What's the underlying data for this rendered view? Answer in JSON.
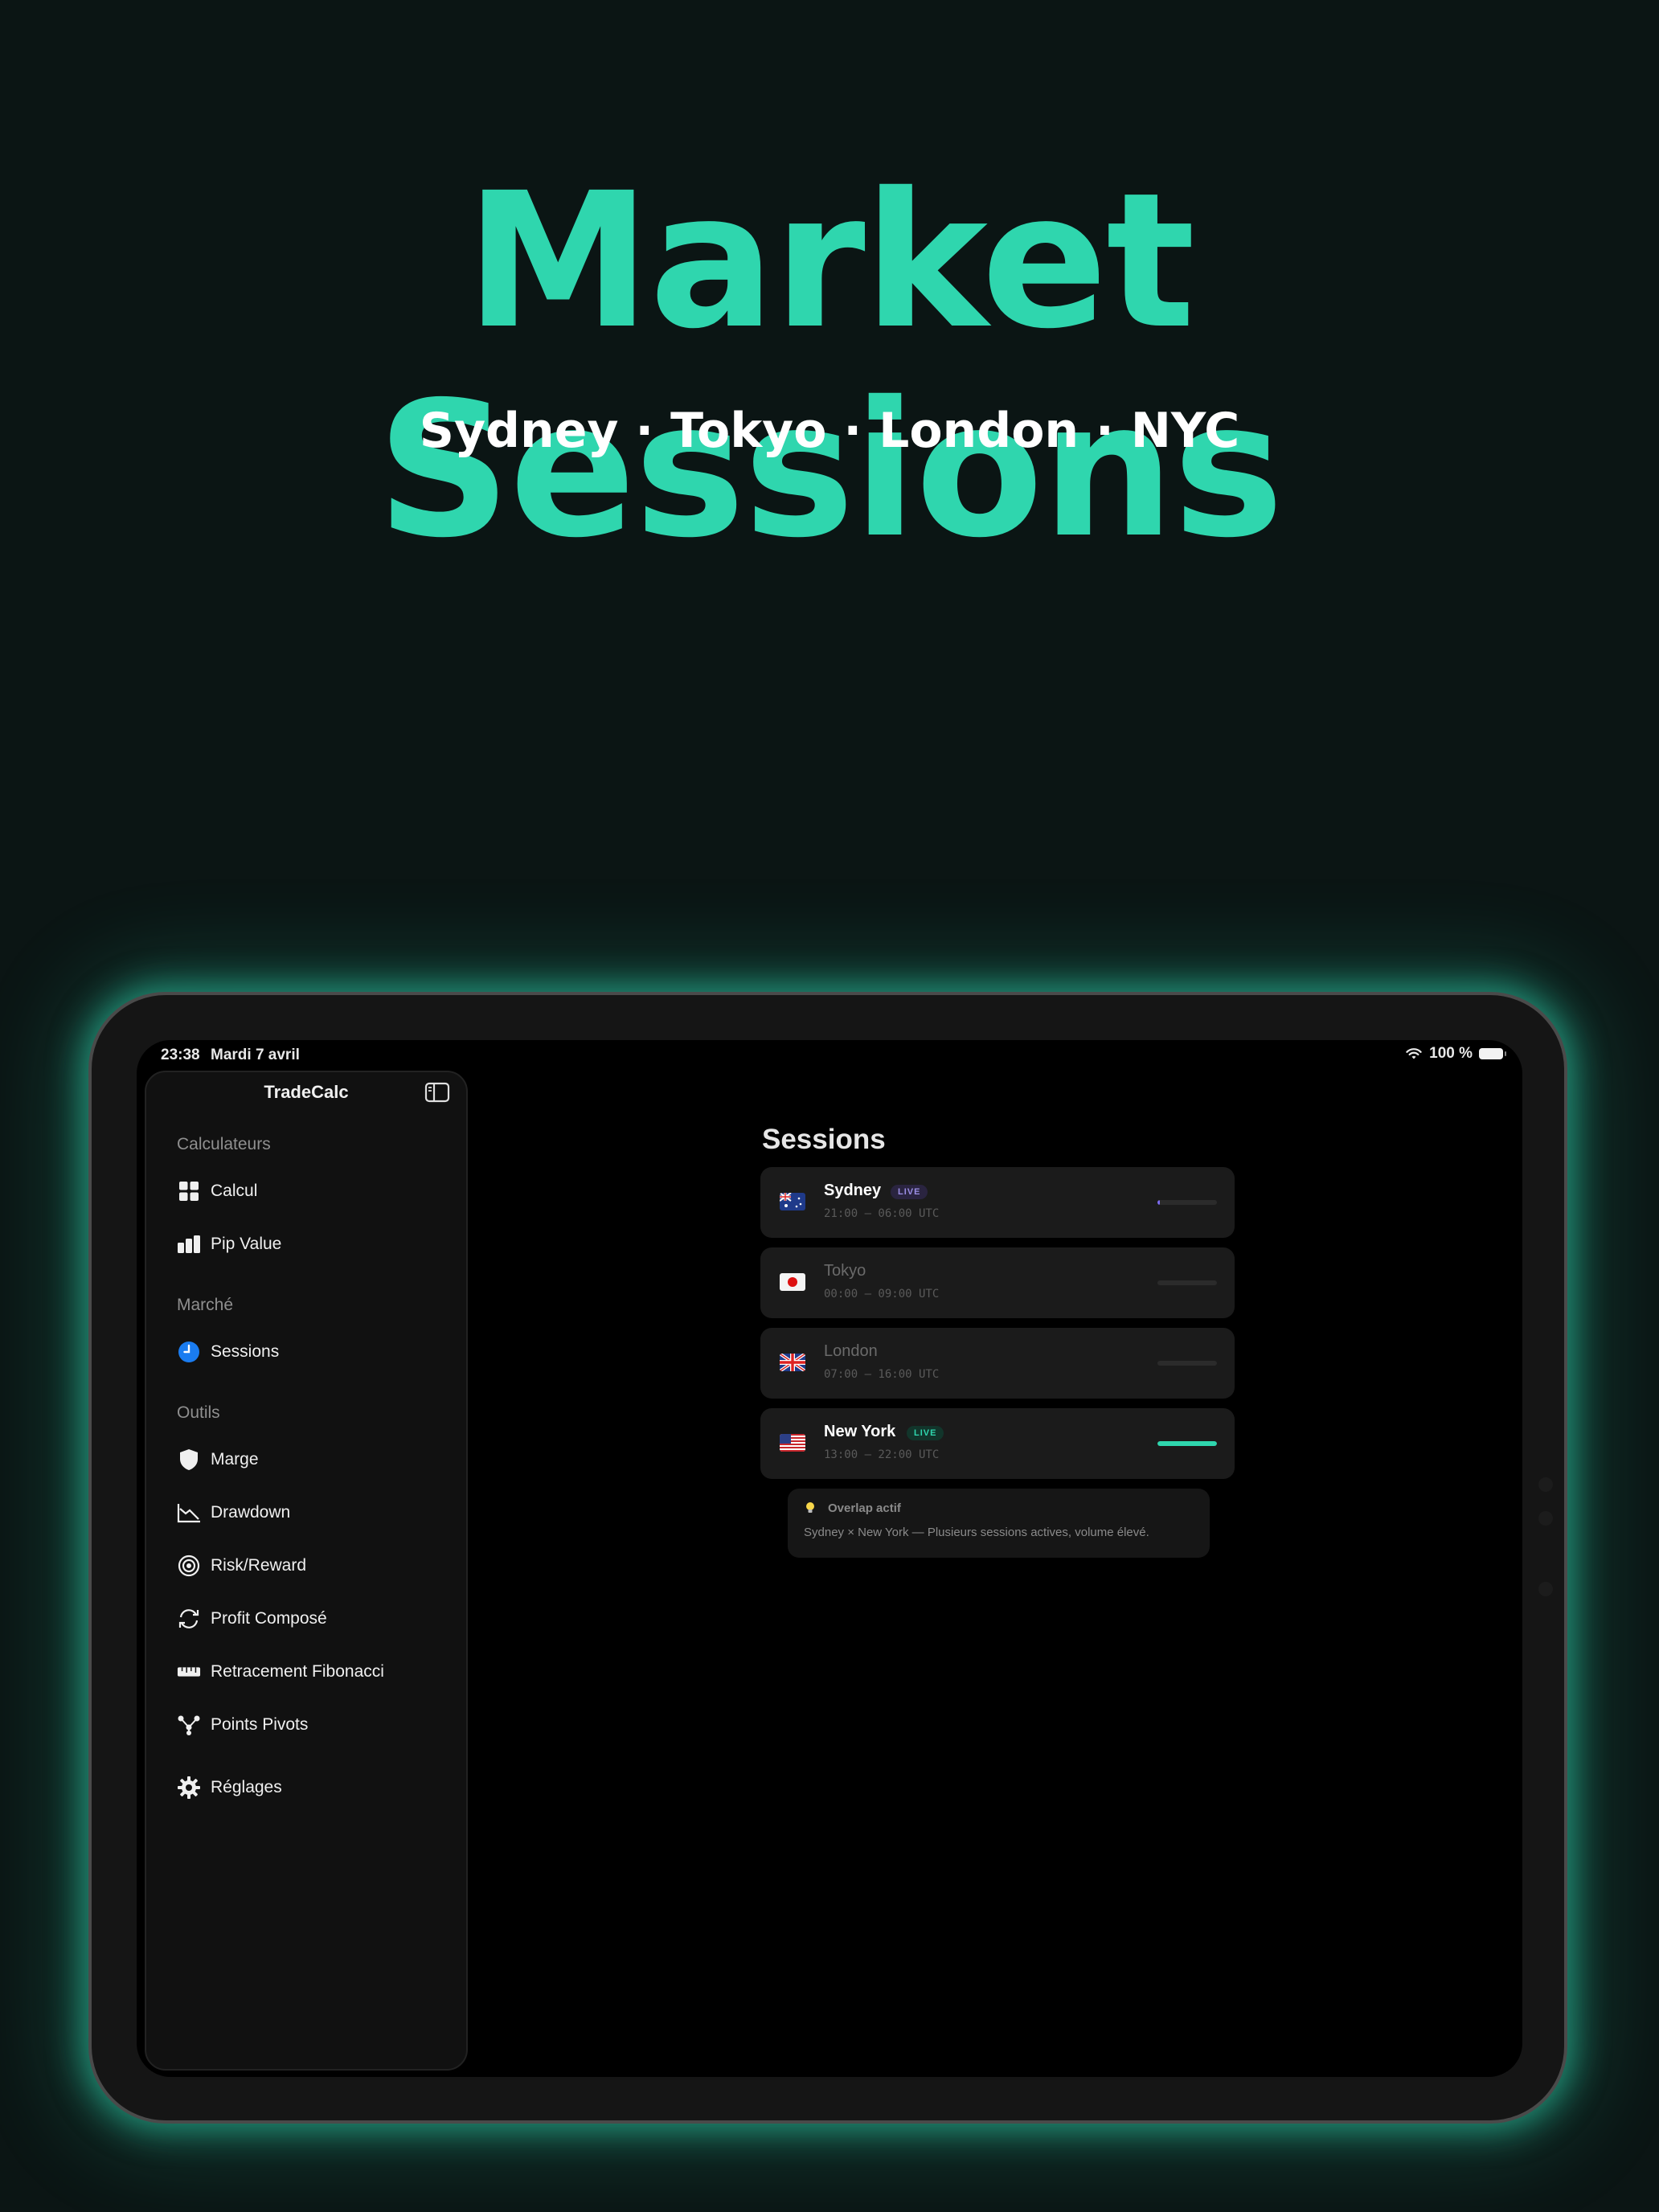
{
  "hero": {
    "title": "Market Sessions",
    "subtitle": "Sydney · Tokyo · London · NYC"
  },
  "status_bar": {
    "time": "23:38",
    "date": "Mardi 7 avril",
    "battery": "100 %"
  },
  "sidebar": {
    "app_title": "TradeCalc",
    "sections": [
      {
        "label": "Calculateurs",
        "items": [
          {
            "label": "Calcul",
            "icon": "grid-icon"
          },
          {
            "label": "Pip Value",
            "icon": "bar-chart-icon"
          }
        ]
      },
      {
        "label": "Marché",
        "items": [
          {
            "label": "Sessions",
            "icon": "clock-icon",
            "selected": true
          }
        ]
      },
      {
        "label": "Outils",
        "items": [
          {
            "label": "Marge",
            "icon": "shield-icon"
          },
          {
            "label": "Drawdown",
            "icon": "chart-down-icon"
          },
          {
            "label": "Risk/Reward",
            "icon": "target-icon"
          },
          {
            "label": "Profit Composé",
            "icon": "refresh-icon"
          },
          {
            "label": "Retracement Fibonacci",
            "icon": "ruler-icon"
          },
          {
            "label": "Points Pivots",
            "icon": "nodes-icon"
          }
        ]
      }
    ],
    "settings_label": "Réglages"
  },
  "main": {
    "title": "Sessions",
    "sessions": [
      {
        "name": "Sydney",
        "hours": "21:00 — 06:00 UTC",
        "live": true,
        "badge": "LIVE",
        "progress": 0.04,
        "color": "#7d6cf2"
      },
      {
        "name": "Tokyo",
        "hours": "00:00 — 09:00 UTC",
        "live": false,
        "progress": 0
      },
      {
        "name": "London",
        "hours": "07:00 — 16:00 UTC",
        "live": false,
        "progress": 0
      },
      {
        "name": "New York",
        "hours": "13:00 — 22:00 UTC",
        "live": true,
        "badge": "LIVE",
        "progress": 1.0,
        "color": "#2fd6ae"
      }
    ],
    "overlap": {
      "title": "Overlap actif",
      "text": "Sydney × New York — Plusieurs sessions actives, volume élevé."
    }
  },
  "colors": {
    "accent": "#2fd6ae",
    "background": "#0b1514"
  }
}
